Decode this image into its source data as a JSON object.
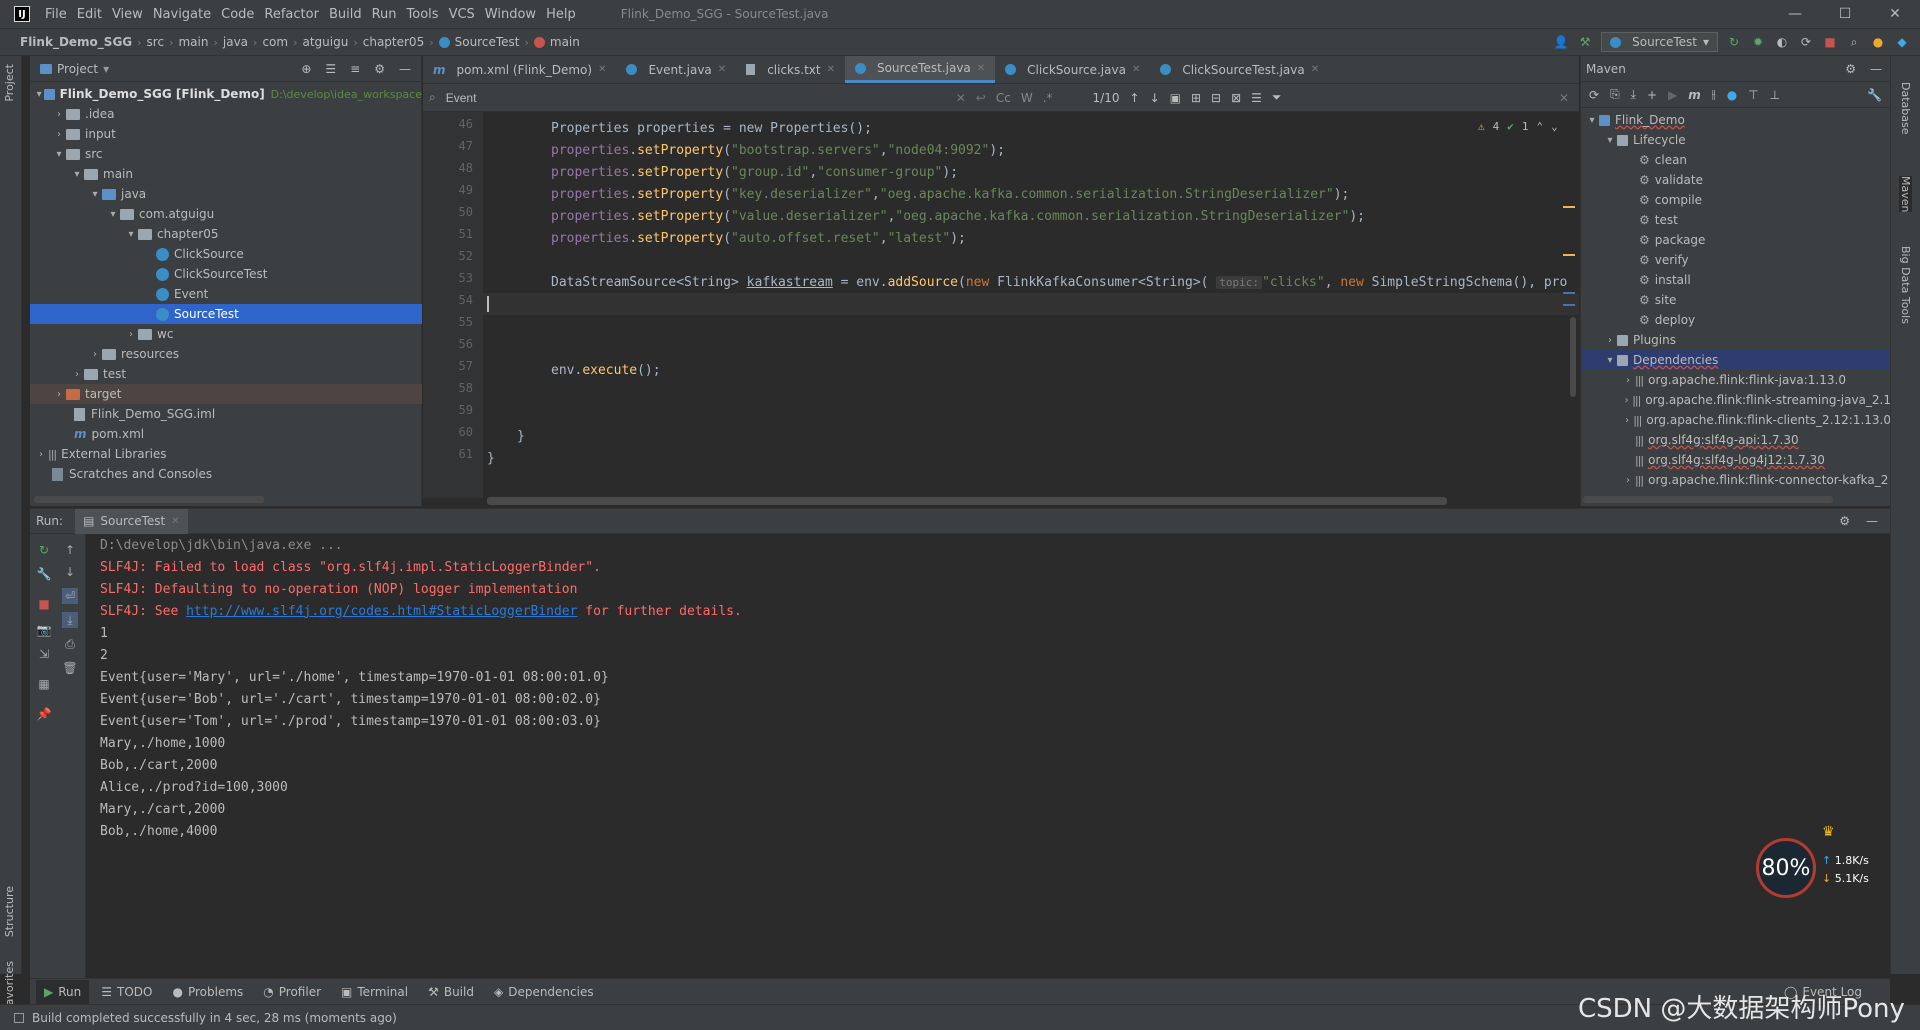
{
  "window": {
    "title": "Flink_Demo_SGG - SourceTest.java",
    "menu": [
      "File",
      "Edit",
      "View",
      "Navigate",
      "Code",
      "Refactor",
      "Build",
      "Run",
      "Tools",
      "VCS",
      "Window",
      "Help"
    ]
  },
  "breadcrumb": [
    "Flink_Demo_SGG",
    "src",
    "main",
    "java",
    "com",
    "atguigu",
    "chapter05",
    "SourceTest",
    "main"
  ],
  "run_config": "SourceTest",
  "project": {
    "header": "Project",
    "root_name": "Flink_Demo_SGG [Flink_Demo]",
    "root_path": "D:\\develop\\idea_workspace",
    "nodes": [
      ".idea",
      "input",
      "src",
      "main",
      "java",
      "com.atguigu",
      "chapter05",
      "ClickSource",
      "ClickSourceTest",
      "Event",
      "SourceTest",
      "wc",
      "resources",
      "test",
      "target",
      "Flink_Demo_SGG.iml",
      "pom.xml",
      "External Libraries",
      "Scratches and Consoles"
    ]
  },
  "editor": {
    "tabs": [
      "pom.xml (Flink_Demo)",
      "Event.java",
      "clicks.txt",
      "SourceTest.java",
      "ClickSource.java",
      "ClickSourceTest.java"
    ],
    "active_tab": "SourceTest.java",
    "find_query": "Event",
    "find_count": "1/10",
    "find_opts": [
      "Cc",
      "W",
      ".*"
    ],
    "warnings": "4",
    "ok": "1",
    "line_numbers": [
      "46",
      "47",
      "48",
      "49",
      "50",
      "51",
      "52",
      "53",
      "54",
      "55",
      "56",
      "57",
      "58",
      "59",
      "60",
      "61"
    ],
    "code": {
      "l46": "Properties properties = new Properties();",
      "l47_a": "bootstrap.servers",
      "l47_b": "node04:9092",
      "l48_a": "group.id",
      "l48_b": "consumer-group",
      "l49_a": "key.deserializer",
      "l49_b": "oeg.apache.kafka.common.serialization.StringDeserializer",
      "l50_a": "value.deserializer",
      "l50_b": "oeg.apache.kafka.common.serialization.StringDeserializer",
      "l51_a": "auto.offset.reset",
      "l51_b": "latest",
      "l53_hint": "topic:",
      "l53_topic": "clicks"
    }
  },
  "maven": {
    "title": "Maven",
    "project": "Flink_Demo",
    "lifecycle": "Lifecycle",
    "phases": [
      "clean",
      "validate",
      "compile",
      "test",
      "package",
      "verify",
      "install",
      "site",
      "deploy"
    ],
    "plugins": "Plugins",
    "dependencies": "Dependencies",
    "deps": [
      "org.apache.flink:flink-java:1.13.0",
      "org.apache.flink:flink-streaming-java_2.1",
      "org.apache.flink:flink-clients_2.12:1.13.0",
      "org.slf4g:slf4g-api:1.7.30",
      "org.slf4g:slf4g-log4j12:1.7.30",
      "org.apache.flink:flink-connector-kafka_2"
    ]
  },
  "side_tabs": {
    "left": [
      "Project",
      "Structure",
      "Favorites"
    ],
    "right": [
      "Database",
      "Maven",
      "Big Data Tools"
    ]
  },
  "run": {
    "label": "Run:",
    "tab": "SourceTest",
    "console": [
      "D:\\develop\\jdk\\bin\\java.exe ...",
      "SLF4J: Failed to load class \"org.slf4j.impl.StaticLoggerBinder\".",
      "SLF4J: Defaulting to no-operation (NOP) logger implementation",
      "1",
      "2",
      "Event{user='Mary', url='./home', timestamp=1970-01-01 08:00:01.0}",
      "Event{user='Bob', url='./cart', timestamp=1970-01-01 08:00:02.0}",
      "Event{user='Tom', url='./prod', timestamp=1970-01-01 08:00:03.0}",
      "Mary,./home,1000",
      "Bob,./cart,2000",
      "Alice,./prod?id=100,3000",
      "Mary,./cart,2000",
      "Bob,./home,4000"
    ],
    "see_prefix": "SLF4J: See ",
    "see_link": "http://www.slf4j.org/codes.html#StaticLoggerBinder",
    "see_suffix": " for further details."
  },
  "widget": {
    "cpu": "80%",
    "up": "1.8K/s",
    "down": "5.1K/s"
  },
  "bottom_tools": [
    "Run",
    "TODO",
    "Problems",
    "Profiler",
    "Terminal",
    "Build",
    "Dependencies"
  ],
  "event_log": "Event Log",
  "status": "Build completed successfully in 4 sec, 28 ms (moments ago)",
  "watermark": "CSDN @大数据架构师Pony"
}
